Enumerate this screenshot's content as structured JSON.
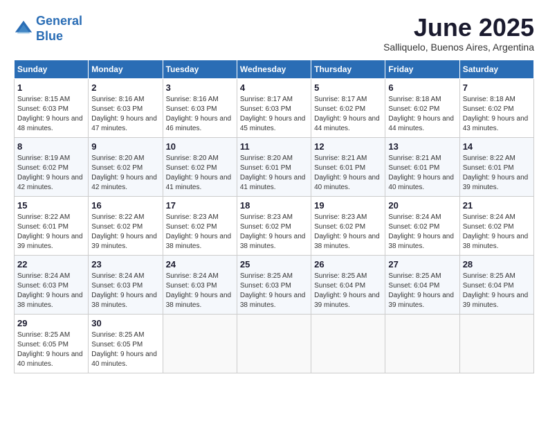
{
  "logo": {
    "line1": "General",
    "line2": "Blue"
  },
  "title": "June 2025",
  "subtitle": "Salliquelo, Buenos Aires, Argentina",
  "days_of_week": [
    "Sunday",
    "Monday",
    "Tuesday",
    "Wednesday",
    "Thursday",
    "Friday",
    "Saturday"
  ],
  "weeks": [
    [
      {
        "day": "1",
        "rise": "Sunrise: 8:15 AM",
        "set": "Sunset: 6:03 PM",
        "daylight": "Daylight: 9 hours and 48 minutes."
      },
      {
        "day": "2",
        "rise": "Sunrise: 8:16 AM",
        "set": "Sunset: 6:03 PM",
        "daylight": "Daylight: 9 hours and 47 minutes."
      },
      {
        "day": "3",
        "rise": "Sunrise: 8:16 AM",
        "set": "Sunset: 6:03 PM",
        "daylight": "Daylight: 9 hours and 46 minutes."
      },
      {
        "day": "4",
        "rise": "Sunrise: 8:17 AM",
        "set": "Sunset: 6:03 PM",
        "daylight": "Daylight: 9 hours and 45 minutes."
      },
      {
        "day": "5",
        "rise": "Sunrise: 8:17 AM",
        "set": "Sunset: 6:02 PM",
        "daylight": "Daylight: 9 hours and 44 minutes."
      },
      {
        "day": "6",
        "rise": "Sunrise: 8:18 AM",
        "set": "Sunset: 6:02 PM",
        "daylight": "Daylight: 9 hours and 44 minutes."
      },
      {
        "day": "7",
        "rise": "Sunrise: 8:18 AM",
        "set": "Sunset: 6:02 PM",
        "daylight": "Daylight: 9 hours and 43 minutes."
      }
    ],
    [
      {
        "day": "8",
        "rise": "Sunrise: 8:19 AM",
        "set": "Sunset: 6:02 PM",
        "daylight": "Daylight: 9 hours and 42 minutes."
      },
      {
        "day": "9",
        "rise": "Sunrise: 8:20 AM",
        "set": "Sunset: 6:02 PM",
        "daylight": "Daylight: 9 hours and 42 minutes."
      },
      {
        "day": "10",
        "rise": "Sunrise: 8:20 AM",
        "set": "Sunset: 6:02 PM",
        "daylight": "Daylight: 9 hours and 41 minutes."
      },
      {
        "day": "11",
        "rise": "Sunrise: 8:20 AM",
        "set": "Sunset: 6:01 PM",
        "daylight": "Daylight: 9 hours and 41 minutes."
      },
      {
        "day": "12",
        "rise": "Sunrise: 8:21 AM",
        "set": "Sunset: 6:01 PM",
        "daylight": "Daylight: 9 hours and 40 minutes."
      },
      {
        "day": "13",
        "rise": "Sunrise: 8:21 AM",
        "set": "Sunset: 6:01 PM",
        "daylight": "Daylight: 9 hours and 40 minutes."
      },
      {
        "day": "14",
        "rise": "Sunrise: 8:22 AM",
        "set": "Sunset: 6:01 PM",
        "daylight": "Daylight: 9 hours and 39 minutes."
      }
    ],
    [
      {
        "day": "15",
        "rise": "Sunrise: 8:22 AM",
        "set": "Sunset: 6:01 PM",
        "daylight": "Daylight: 9 hours and 39 minutes."
      },
      {
        "day": "16",
        "rise": "Sunrise: 8:22 AM",
        "set": "Sunset: 6:02 PM",
        "daylight": "Daylight: 9 hours and 39 minutes."
      },
      {
        "day": "17",
        "rise": "Sunrise: 8:23 AM",
        "set": "Sunset: 6:02 PM",
        "daylight": "Daylight: 9 hours and 38 minutes."
      },
      {
        "day": "18",
        "rise": "Sunrise: 8:23 AM",
        "set": "Sunset: 6:02 PM",
        "daylight": "Daylight: 9 hours and 38 minutes."
      },
      {
        "day": "19",
        "rise": "Sunrise: 8:23 AM",
        "set": "Sunset: 6:02 PM",
        "daylight": "Daylight: 9 hours and 38 minutes."
      },
      {
        "day": "20",
        "rise": "Sunrise: 8:24 AM",
        "set": "Sunset: 6:02 PM",
        "daylight": "Daylight: 9 hours and 38 minutes."
      },
      {
        "day": "21",
        "rise": "Sunrise: 8:24 AM",
        "set": "Sunset: 6:02 PM",
        "daylight": "Daylight: 9 hours and 38 minutes."
      }
    ],
    [
      {
        "day": "22",
        "rise": "Sunrise: 8:24 AM",
        "set": "Sunset: 6:03 PM",
        "daylight": "Daylight: 9 hours and 38 minutes."
      },
      {
        "day": "23",
        "rise": "Sunrise: 8:24 AM",
        "set": "Sunset: 6:03 PM",
        "daylight": "Daylight: 9 hours and 38 minutes."
      },
      {
        "day": "24",
        "rise": "Sunrise: 8:24 AM",
        "set": "Sunset: 6:03 PM",
        "daylight": "Daylight: 9 hours and 38 minutes."
      },
      {
        "day": "25",
        "rise": "Sunrise: 8:25 AM",
        "set": "Sunset: 6:03 PM",
        "daylight": "Daylight: 9 hours and 38 minutes."
      },
      {
        "day": "26",
        "rise": "Sunrise: 8:25 AM",
        "set": "Sunset: 6:04 PM",
        "daylight": "Daylight: 9 hours and 39 minutes."
      },
      {
        "day": "27",
        "rise": "Sunrise: 8:25 AM",
        "set": "Sunset: 6:04 PM",
        "daylight": "Daylight: 9 hours and 39 minutes."
      },
      {
        "day": "28",
        "rise": "Sunrise: 8:25 AM",
        "set": "Sunset: 6:04 PM",
        "daylight": "Daylight: 9 hours and 39 minutes."
      }
    ],
    [
      {
        "day": "29",
        "rise": "Sunrise: 8:25 AM",
        "set": "Sunset: 6:05 PM",
        "daylight": "Daylight: 9 hours and 40 minutes."
      },
      {
        "day": "30",
        "rise": "Sunrise: 8:25 AM",
        "set": "Sunset: 6:05 PM",
        "daylight": "Daylight: 9 hours and 40 minutes."
      },
      null,
      null,
      null,
      null,
      null
    ]
  ]
}
